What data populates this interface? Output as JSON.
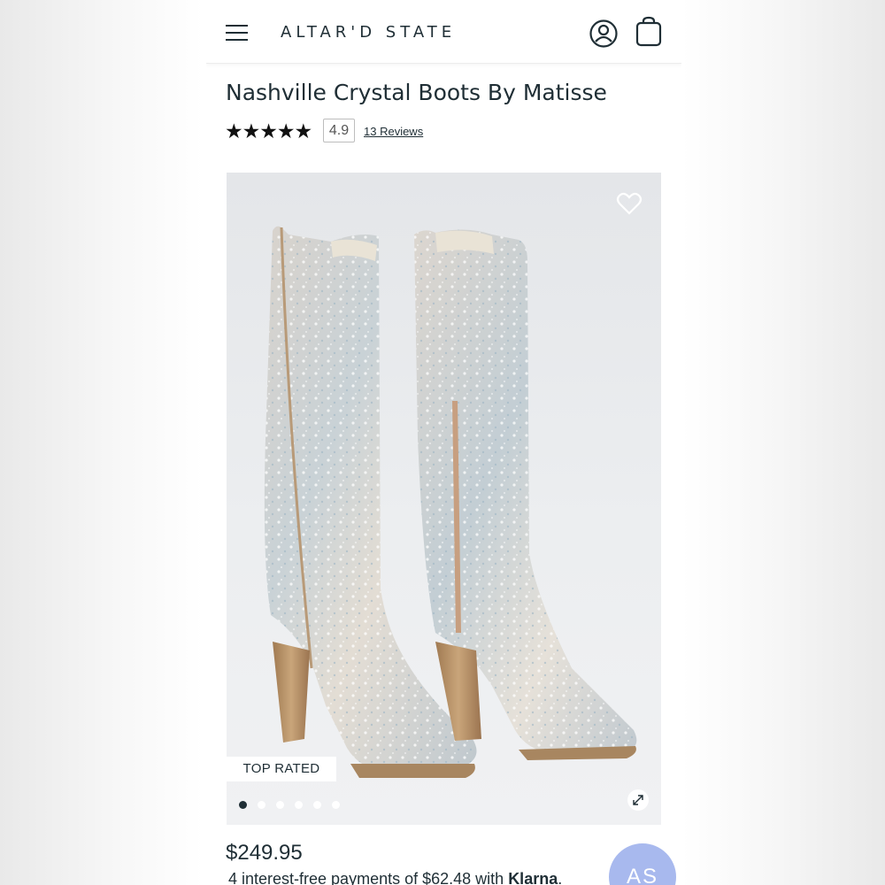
{
  "header": {
    "brand": "ALTAR'D STATE",
    "icons": [
      "menu-icon",
      "account-icon",
      "shopping-bag-icon"
    ]
  },
  "product": {
    "title": "Nashville Crystal Boots By Matisse",
    "stars": "★★★★★",
    "rating": "4.9",
    "reviews_label": "13 Reviews",
    "badge": "TOP RATED",
    "image_count": 6,
    "active_image": 1,
    "price": "$249.95",
    "klarna_text": "4 interest-free payments of $62.48 with",
    "klarna_brand": "Klarna",
    "klarna_suffix": "."
  },
  "chat": {
    "label": "AS"
  },
  "colors": {
    "text": "#1f2e35",
    "chat_bubble": "#a8b9ee",
    "image_bg": "#e4e6e9"
  }
}
